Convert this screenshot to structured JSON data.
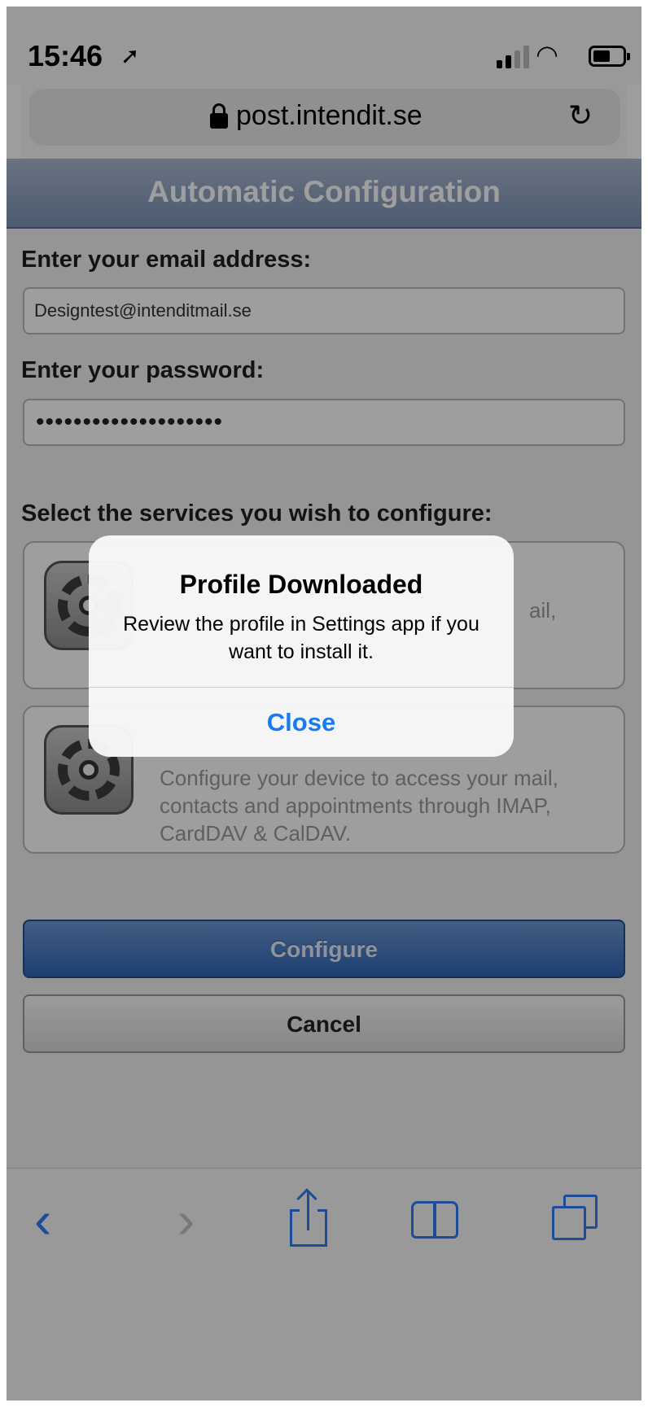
{
  "status_bar": {
    "time": "15:46",
    "location_icon": "location-arrow-icon",
    "signal_icon": "signal-icon",
    "wifi_icon": "wifi-icon",
    "battery_icon": "battery-icon"
  },
  "url_bar": {
    "url": "post.intendit.se",
    "lock_icon": "lock-icon",
    "reload_icon": "reload-icon"
  },
  "page": {
    "header_title": "Automatic Configuration",
    "email_label": "Enter your email address:",
    "email_value": "Designtest@intenditmail.se",
    "password_label": "Enter your password:",
    "password_value": "••••••••••••••••••••",
    "services_label": "Select the services you wish to configure:",
    "services": [
      {
        "icon": "gear-icon",
        "visible_text": "ail,"
      },
      {
        "icon": "gear-icon",
        "description": "Configure your device to access your mail, contacts and appointments through IMAP, CardDAV & CalDAV."
      }
    ],
    "configure_label": "Configure",
    "cancel_label": "Cancel"
  },
  "alert": {
    "title": "Profile Downloaded",
    "message": "Review the profile in Settings app if you want to install it.",
    "button": "Close"
  },
  "toolbar": {
    "back": "‹",
    "forward": "›",
    "icons": [
      "back-icon",
      "forward-icon",
      "share-icon",
      "bookmarks-icon",
      "tabs-icon"
    ]
  },
  "colors": {
    "accent": "#1a7af0",
    "header": "#7d93b4",
    "configure_button": "#2f66b6"
  }
}
